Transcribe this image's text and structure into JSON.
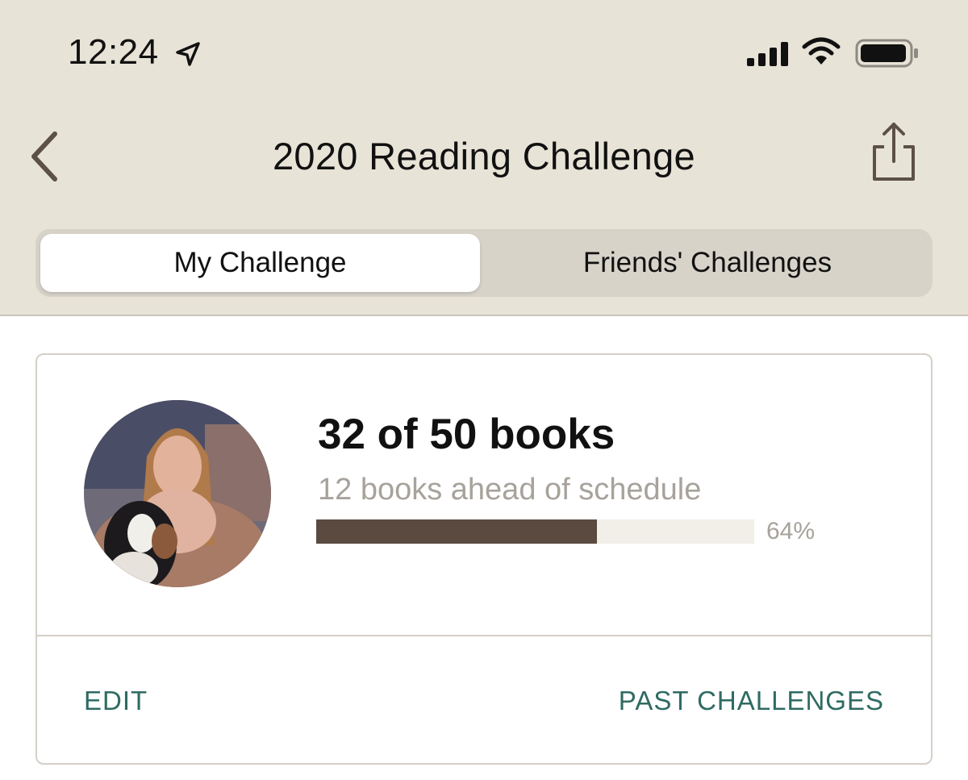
{
  "status_bar": {
    "time": "12:24",
    "location_icon": "location-arrow-icon",
    "signal_icon": "cellular-signal-icon",
    "wifi_icon": "wifi-icon",
    "battery_icon": "battery-icon"
  },
  "nav": {
    "back_icon": "chevron-left-icon",
    "title": "2020 Reading Challenge",
    "share_icon": "share-icon"
  },
  "tabs": [
    {
      "label": "My Challenge",
      "selected": true
    },
    {
      "label": "Friends' Challenges",
      "selected": false
    }
  ],
  "challenge": {
    "books_text": "32 of 50 books",
    "schedule_text": "12 books ahead of schedule",
    "progress_fraction": 0.64,
    "progress_label": "64%"
  },
  "actions": {
    "edit_label": "EDIT",
    "past_label": "PAST CHALLENGES"
  },
  "colors": {
    "header_bg": "#e8e3d7",
    "progress_fill": "#5a4a3f",
    "progress_track": "#f2efe8",
    "accent_text": "#2f6b62",
    "secondary_text": "#a7a29b"
  }
}
